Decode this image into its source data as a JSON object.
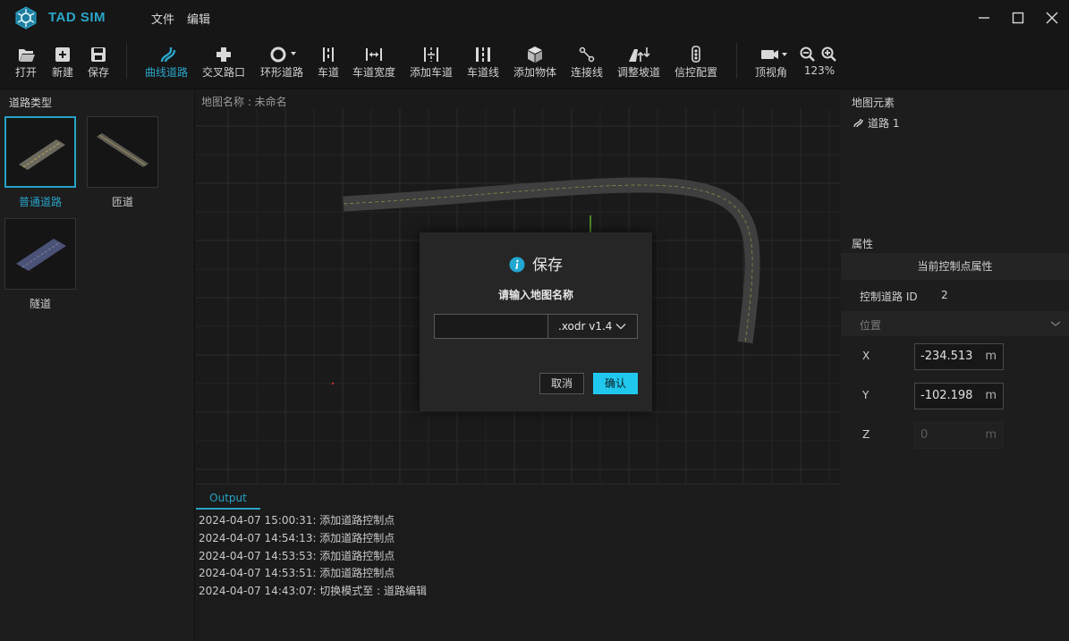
{
  "app": {
    "brand": "TAD SIM",
    "menus": [
      "文件",
      "编辑"
    ]
  },
  "toolbar": {
    "open": "打开",
    "new": "新建",
    "save": "保存",
    "curve_road": "曲线道路",
    "junction": "交叉路口",
    "roundabout": "环形道路",
    "lane": "车道",
    "lane_width": "车道宽度",
    "add_lane": "添加车道",
    "lane_line": "车道线",
    "add_object": "添加物体",
    "connect_line": "连接线",
    "adjust_slope": "调整坡道",
    "signal_config": "信控配置",
    "top_view": "顶视角",
    "zoom": "123%"
  },
  "left_panel": {
    "title": "道路类型",
    "items": [
      {
        "label": "普通道路",
        "selected": true
      },
      {
        "label": "匝道",
        "selected": false
      },
      {
        "label": "隧道",
        "selected": false
      }
    ]
  },
  "viewport": {
    "map_name": "地图名称 : 未命名"
  },
  "output": {
    "tab": "Output",
    "logs": [
      "2024-04-07 15:00:31: 添加道路控制点",
      "2024-04-07 14:54:13: 添加道路控制点",
      "2024-04-07 14:53:53: 添加道路控制点",
      "2024-04-07 14:53:51: 添加道路控制点",
      "2024-04-07 14:43:07: 切换模式至 : 道路编辑"
    ]
  },
  "right_panel": {
    "elements_title": "地图元素",
    "element_item": "道路 1",
    "properties_title": "属性",
    "current_point": "当前控制点属性",
    "road_id_label": "控制道路 ID",
    "road_id_value": "2",
    "position_label": "位置",
    "x_label": "X",
    "x_value": "-234.513",
    "y_label": "Y",
    "y_value": "-102.198",
    "z_label": "Z",
    "z_value": "0",
    "unit": "m"
  },
  "dialog": {
    "title": "保存",
    "prompt": "请输入地图名称",
    "name_value": "",
    "format": ".xodr v1.4",
    "cancel": "取消",
    "ok": "确认"
  },
  "colors": {
    "accent": "#27a2c6",
    "ok_button": "#20c8ee"
  }
}
